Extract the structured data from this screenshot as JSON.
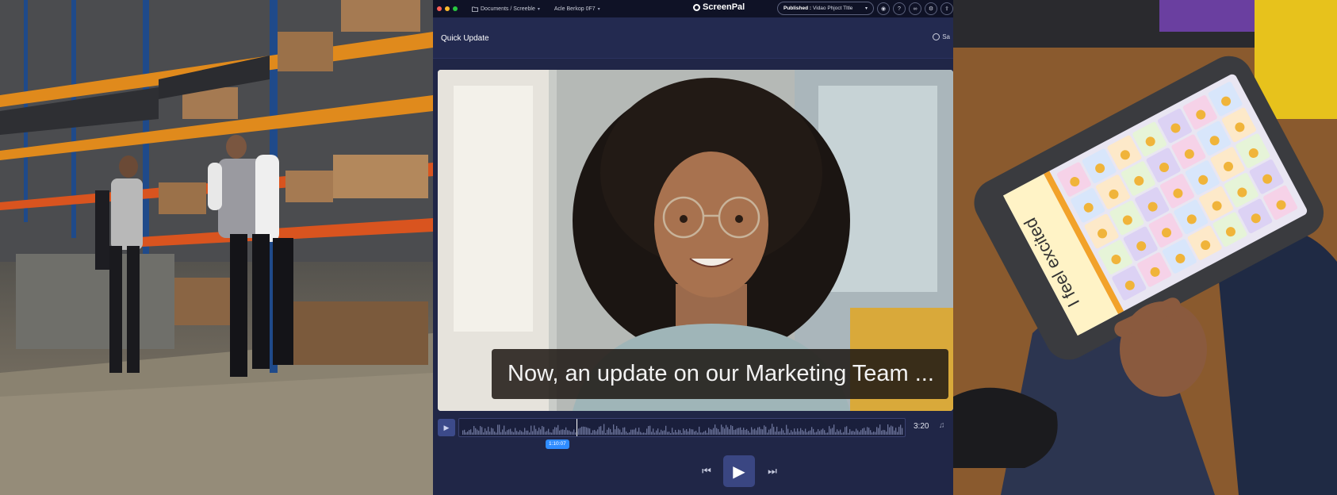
{
  "window": {
    "breadcrumb": "Documents / Screeble",
    "project": "Acle Berkop 0F7",
    "brand": "ScreenPal",
    "publish_prefix": "Published :",
    "publish_title": "Vidao Phjoct Tltle"
  },
  "header": {
    "title": "Quick Update",
    "save_label": "Sa"
  },
  "video": {
    "caption": "Now, an update on our Marketing Team ..."
  },
  "timeline": {
    "duration": "3:20",
    "playhead_time": "1:10:07"
  },
  "tablet": {
    "heading": "I feel excited"
  },
  "colors": {
    "app_bg": "#202647",
    "titlebar_bg": "#0f1226",
    "accent": "#2f8cff",
    "play_button": "#3a4682"
  },
  "icons": {
    "folder": "folder-icon",
    "play": "play-icon",
    "prev": "skip-back-icon",
    "next": "skip-forward-icon",
    "music": "music-note-icon"
  }
}
